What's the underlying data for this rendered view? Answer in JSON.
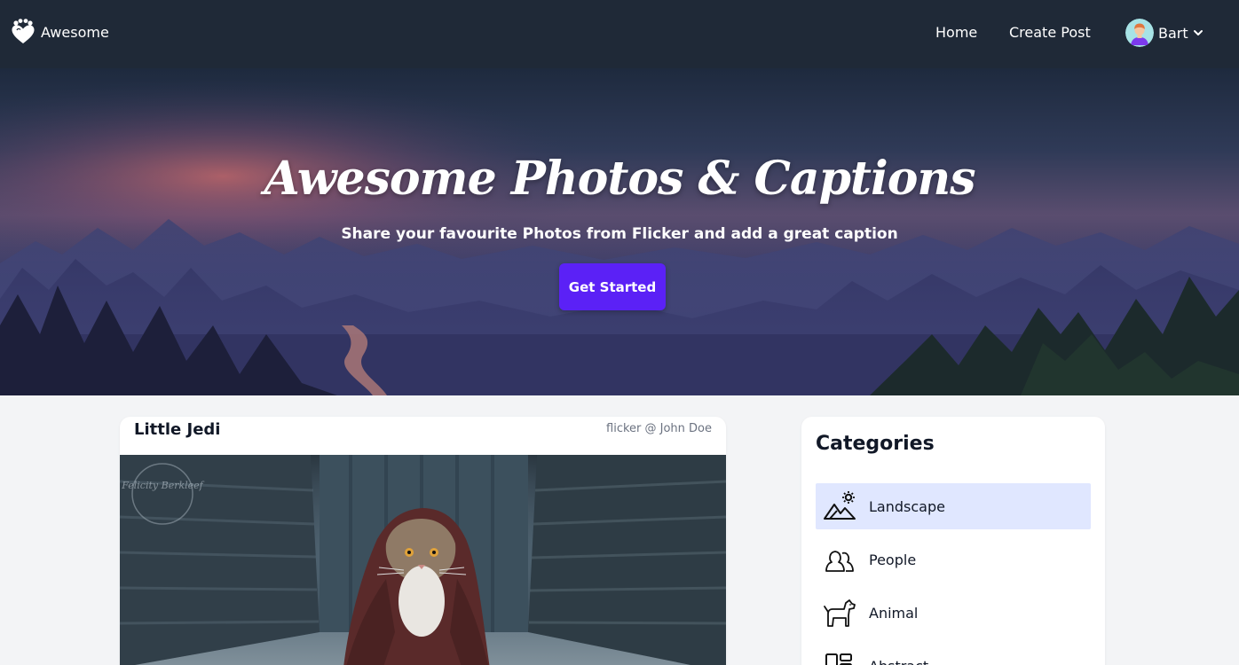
{
  "navbar": {
    "brand_name": "Awesome",
    "brand_icon": "heart-paw-icon",
    "links": [
      {
        "label": "Home"
      },
      {
        "label": "Create Post"
      }
    ],
    "user": {
      "name": "Bart",
      "avatar_icon": "avatar-icon",
      "menu_icon": "chevron-down-icon"
    }
  },
  "hero": {
    "title": "Awesome Photos & Captions",
    "subtitle": "Share your favourite Photos from Flicker and add a great caption",
    "cta_label": "Get Started",
    "cta_color": "#5b21f6"
  },
  "post": {
    "title": "Little Jedi",
    "credit": "flicker @ John Doe",
    "watermark": "Felicity Berkleef"
  },
  "categories": {
    "heading": "Categories",
    "items": [
      {
        "label": "Landscape",
        "icon": "landscape-icon",
        "active": true
      },
      {
        "label": "People",
        "icon": "people-icon",
        "active": false
      },
      {
        "label": "Animal",
        "icon": "dog-icon",
        "active": false
      },
      {
        "label": "Abstract",
        "icon": "abstract-icon",
        "active": false
      }
    ],
    "active_color": "#e0e7ff"
  },
  "colors": {
    "nav_bg": "#1f2937",
    "page_bg": "#f3f4f6",
    "accent": "#5b21f6"
  }
}
